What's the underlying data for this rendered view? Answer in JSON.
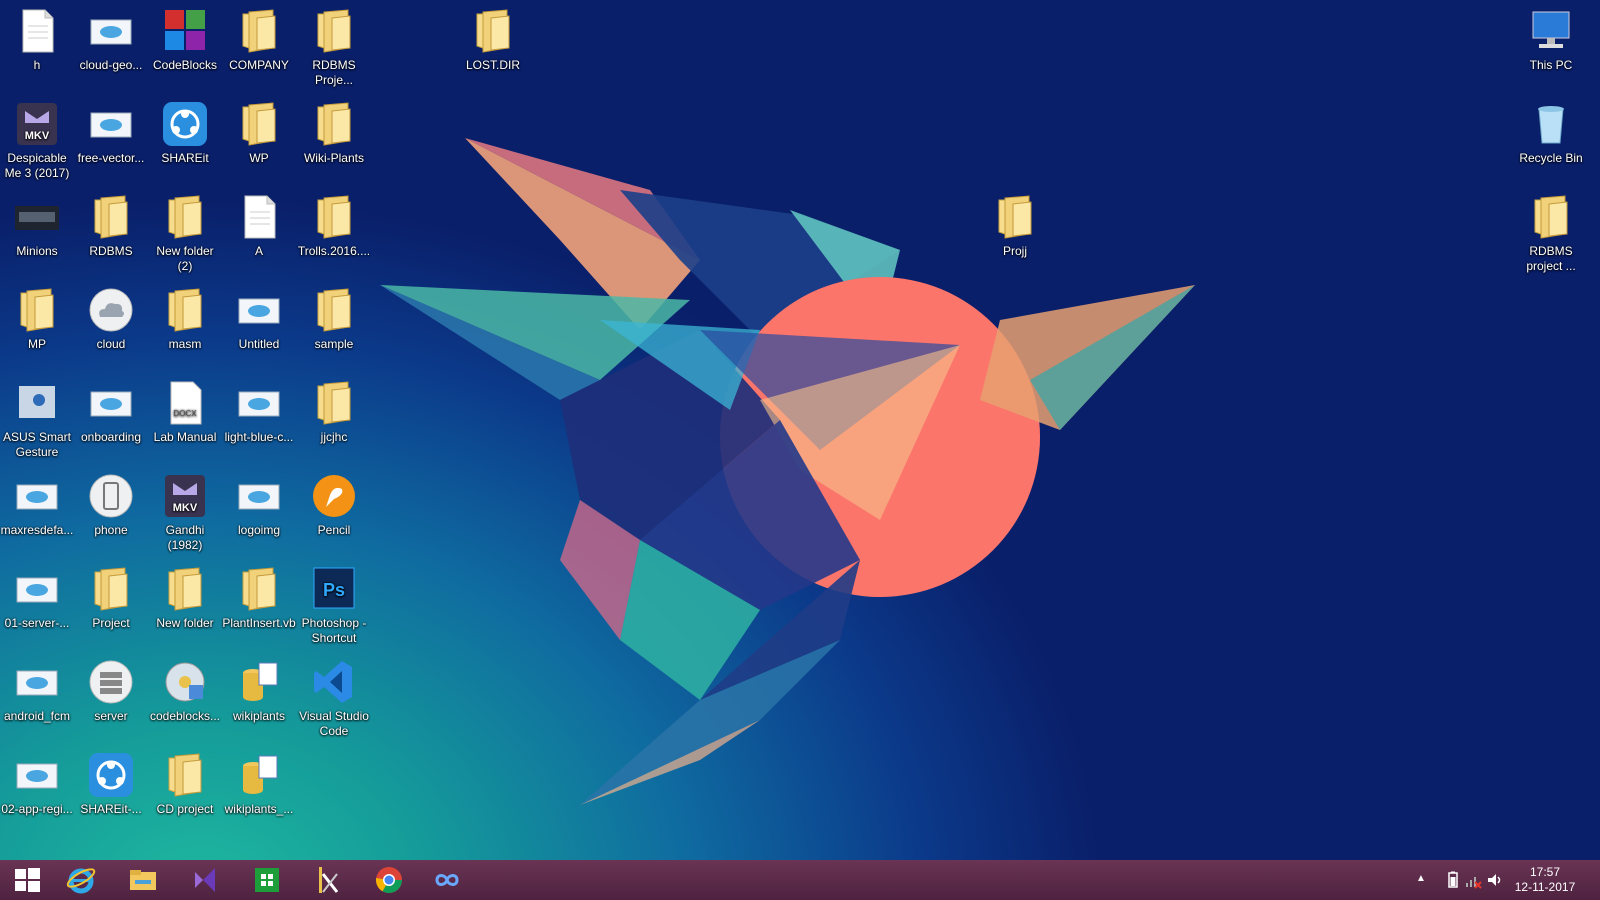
{
  "colors": {
    "taskbar": "#5a2a4a",
    "folder": "#f1d27a",
    "accent_blue": "#2b8fe0"
  },
  "desktop": {
    "left_icons": [
      {
        "label": "h",
        "icon": "document-icon",
        "col": 0,
        "row": 0
      },
      {
        "label": "cloud-geo...",
        "icon": "image-icon",
        "col": 1,
        "row": 0
      },
      {
        "label": "CodeBlocks",
        "icon": "codeblocks-icon",
        "col": 2,
        "row": 0
      },
      {
        "label": "COMPANY",
        "icon": "folder-icon",
        "col": 3,
        "row": 0
      },
      {
        "label": "RDBMS Proje...",
        "icon": "folder-icon",
        "col": 4,
        "row": 0
      },
      {
        "label": "Despicable Me 3 (2017)",
        "icon": "mkv-icon",
        "col": 0,
        "row": 1
      },
      {
        "label": "free-vector...",
        "icon": "image-icon",
        "col": 1,
        "row": 1
      },
      {
        "label": "SHAREit",
        "icon": "shareit-icon",
        "col": 2,
        "row": 1
      },
      {
        "label": "WP",
        "icon": "folder-icon",
        "col": 3,
        "row": 1
      },
      {
        "label": "Wiki-Plants",
        "icon": "folder-icon",
        "col": 4,
        "row": 1
      },
      {
        "label": "Minions",
        "icon": "video-thumb-icon",
        "col": 0,
        "row": 2
      },
      {
        "label": "RDBMS",
        "icon": "folder-icon",
        "col": 1,
        "row": 2
      },
      {
        "label": "New folder (2)",
        "icon": "folder-icon",
        "col": 2,
        "row": 2
      },
      {
        "label": "A",
        "icon": "document-icon",
        "col": 3,
        "row": 2
      },
      {
        "label": "Trolls.2016....",
        "icon": "folder-icon",
        "col": 4,
        "row": 2
      },
      {
        "label": "MP",
        "icon": "folder-icon",
        "col": 0,
        "row": 3
      },
      {
        "label": "cloud",
        "icon": "cloud-icon",
        "col": 1,
        "row": 3
      },
      {
        "label": "masm",
        "icon": "folder-icon",
        "col": 2,
        "row": 3
      },
      {
        "label": "Untitled",
        "icon": "image-icon",
        "col": 3,
        "row": 3
      },
      {
        "label": "sample",
        "icon": "folder-icon",
        "col": 4,
        "row": 3
      },
      {
        "label": "ASUS Smart Gesture",
        "icon": "asus-gesture-icon",
        "col": 0,
        "row": 4
      },
      {
        "label": "onboarding",
        "icon": "image-icon",
        "col": 1,
        "row": 4
      },
      {
        "label": "Lab Manual",
        "icon": "docx-icon",
        "col": 2,
        "row": 4
      },
      {
        "label": "light-blue-c...",
        "icon": "image-icon",
        "col": 3,
        "row": 4
      },
      {
        "label": "jjcjhc",
        "icon": "folder-icon",
        "col": 4,
        "row": 4
      },
      {
        "label": "maxresdefa...",
        "icon": "image-icon",
        "col": 0,
        "row": 5
      },
      {
        "label": "phone",
        "icon": "phone-icon",
        "col": 1,
        "row": 5
      },
      {
        "label": "Gandhi (1982)",
        "icon": "mkv-icon",
        "col": 2,
        "row": 5
      },
      {
        "label": "logoimg",
        "icon": "image-icon",
        "col": 3,
        "row": 5
      },
      {
        "label": "Pencil",
        "icon": "pencil-icon",
        "col": 4,
        "row": 5
      },
      {
        "label": "01-server-...",
        "icon": "image-icon",
        "col": 0,
        "row": 6
      },
      {
        "label": "Project",
        "icon": "folder-icon",
        "col": 1,
        "row": 6
      },
      {
        "label": "New folder",
        "icon": "folder-icon",
        "col": 2,
        "row": 6
      },
      {
        "label": "PlantInsert.vb",
        "icon": "folder-icon",
        "col": 3,
        "row": 6
      },
      {
        "label": "Photoshop - Shortcut",
        "icon": "photoshop-icon",
        "col": 4,
        "row": 6
      },
      {
        "label": "android_fcm",
        "icon": "image-icon",
        "col": 0,
        "row": 7
      },
      {
        "label": "server",
        "icon": "server-icon",
        "col": 1,
        "row": 7
      },
      {
        "label": "codeblocks...",
        "icon": "installer-icon",
        "col": 2,
        "row": 7
      },
      {
        "label": "wikiplants",
        "icon": "database-icon",
        "col": 3,
        "row": 7
      },
      {
        "label": "Visual Studio Code",
        "icon": "vscode-icon",
        "col": 4,
        "row": 7
      },
      {
        "label": "02-app-regi...",
        "icon": "image-icon",
        "col": 0,
        "row": 8
      },
      {
        "label": "SHAREit-...",
        "icon": "shareit-icon",
        "col": 1,
        "row": 8
      },
      {
        "label": "CD project",
        "icon": "folder-icon",
        "col": 2,
        "row": 8
      },
      {
        "label": "wikiplants_...",
        "icon": "database-icon",
        "col": 3,
        "row": 8
      }
    ],
    "extra_icons": [
      {
        "label": "LOST.DIR",
        "icon": "folder-icon",
        "slot": "lostdir"
      },
      {
        "label": "Projj",
        "icon": "folder-icon",
        "slot": "projj"
      },
      {
        "label": "This PC",
        "icon": "this-pc-icon",
        "slot": "thispc"
      },
      {
        "label": "Recycle Bin",
        "icon": "recycle-bin-icon",
        "slot": "recycle"
      },
      {
        "label": "RDBMS project ...",
        "icon": "folder-icon",
        "slot": "rdbms2"
      }
    ]
  },
  "taskbar": {
    "pinned": [
      "start-icon",
      "internet-explorer-icon",
      "file-explorer-icon",
      "visual-studio-icon",
      "store-icon",
      "tools-icon",
      "chrome-icon",
      "infinity-icon"
    ],
    "clock_time": "17:57",
    "clock_date": "12-11-2017"
  }
}
